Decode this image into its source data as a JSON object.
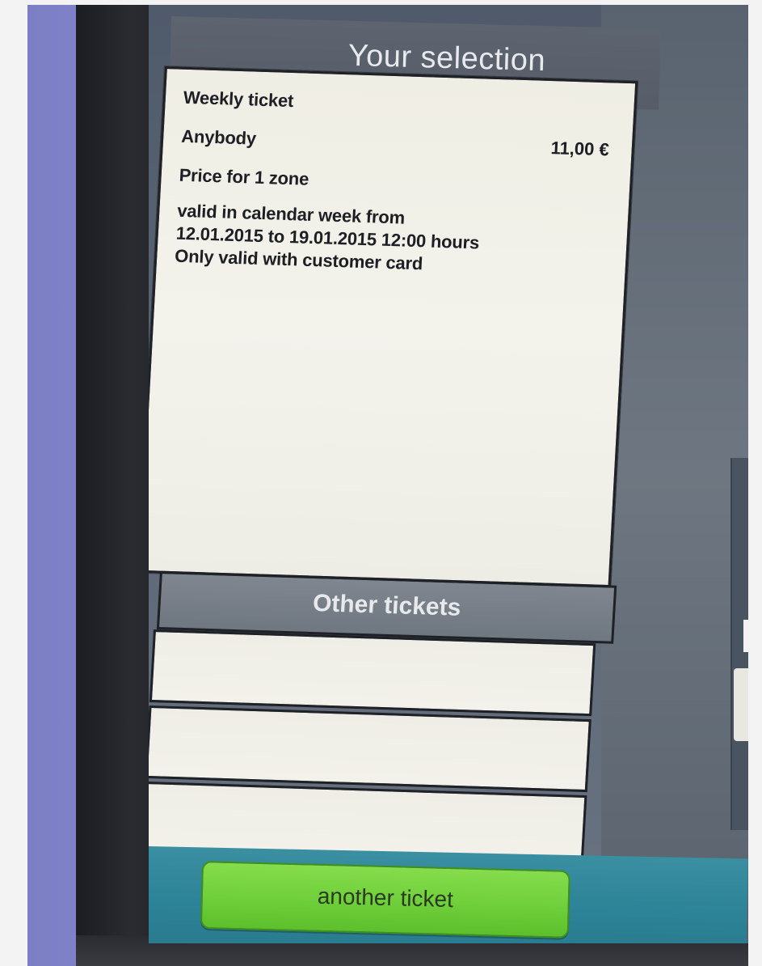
{
  "header": {
    "title": "Your selection"
  },
  "selection": {
    "ticket_type": "Weekly ticket",
    "passenger": "Anybody",
    "price": "11,00 €",
    "zone_info": "Price for 1 zone",
    "validity_line1": "valid in calendar week from",
    "validity_line2": "12.01.2015 to 19.01.2015 12:00 hours",
    "note": "Only valid with customer card"
  },
  "other_tickets": {
    "header": "Other tickets",
    "rows": [
      "",
      "",
      ""
    ]
  },
  "actions": {
    "another_ticket_label": "another ticket"
  },
  "colors": {
    "title_bar": "#5d6470",
    "panel_bg": "#f0efe6",
    "action_bar": "#2c8296",
    "button_green": "#6fcf3a"
  }
}
